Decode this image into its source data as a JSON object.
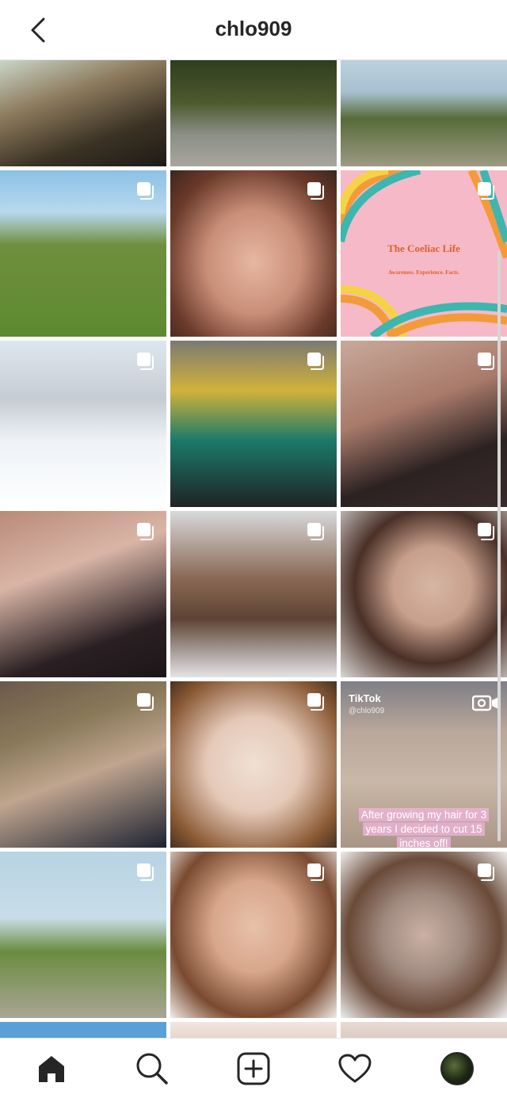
{
  "header": {
    "username": "chlo909"
  },
  "grid": {
    "tiles": [
      {
        "name": "post-selfie-sunset",
        "icon": "none",
        "bg": "linear-gradient(160deg,#c9d6c8 0%,#8c7a5c 35%,#3b3224 70%,#1d1b16 100%)"
      },
      {
        "name": "post-couple-legs-garden",
        "icon": "none",
        "bg": "linear-gradient(180deg,#2e3e1e 0%,#4d5a2e 40%,#8b8f86 70%,#a8a69c 100%)"
      },
      {
        "name": "post-countryside-path",
        "icon": "none",
        "bg": "linear-gradient(180deg,#bcd1de 0%,#a7c0cf 30%,#576b3a 55%,#9d9a83 100%)"
      },
      {
        "name": "post-field-dog",
        "icon": "multi",
        "bg": "linear-gradient(180deg,#8cc1e5 0%,#b7d9ef 25%,#6f8f3e 45%,#5d8a31 100%)"
      },
      {
        "name": "post-rainbow-makeup",
        "icon": "multi",
        "bg": "radial-gradient(ellipse at 50% 55%,#e7b7a2 0%,#c98f78 40%,#6b3a2a 75%,#3d261e 100%)"
      },
      {
        "name": "post-coeliac-graphic",
        "icon": "multi",
        "bg": "#f6b9c8",
        "graphic": true
      },
      {
        "name": "post-snow-walk",
        "icon": "multi",
        "bg": "linear-gradient(180deg,#dfe7ee 0%,#c6ccd3 35%,#eef2f6 60%,#ffffff 100%)"
      },
      {
        "name": "post-snow-couple",
        "icon": "multi",
        "bg": "linear-gradient(180deg,#7b7a72 0%,#d1b23a 30%,#1a7a6a 60%,#1f2324 100%)"
      },
      {
        "name": "post-glasses-dog",
        "icon": "multi",
        "bg": "linear-gradient(160deg,#c9a99a 0%,#a87a6a 40%,#2c2222 70%,#3a2b2b 100%)"
      },
      {
        "name": "post-glasses-selfie",
        "icon": "multi",
        "bg": "linear-gradient(160deg,#b98a7a 0%,#d9b5a6 35%,#2a1f22 75%,#1c1618 100%)"
      },
      {
        "name": "post-snowy-forest-path",
        "icon": "multi",
        "bg": "linear-gradient(180deg,#d8d9db 0%,#8a6a55 40%,#5e4334 65%,#e4e4e6 100%)"
      },
      {
        "name": "post-bob-makeup",
        "icon": "multi",
        "bg": "radial-gradient(ellipse at 55% 45%,#d7b6a4 0%,#c79f8c 30%,#4a3027 60%,#d9d6d2 100%)"
      },
      {
        "name": "post-christmas-tree-couple",
        "icon": "multi",
        "bg": "linear-gradient(160deg,#6b5a4a 0%,#8a7a5a 30%,#c0a58f 55%,#1d2331 100%)"
      },
      {
        "name": "post-flower-makeup",
        "icon": "multi",
        "bg": "radial-gradient(ellipse at 50% 50%,#f0e0d4 0%,#e5c9b8 40%,#8a5a35 80%,#4a3020 100%)"
      },
      {
        "name": "post-tiktok-pavement",
        "icon": "video",
        "bg": "linear-gradient(180deg,#7f7f86 0%,#b9a79b 30%,#c9b7a8 60%,#a89585 100%)",
        "tiktok": true
      },
      {
        "name": "post-lane-walk",
        "icon": "multi",
        "bg": "linear-gradient(180deg,#b8d3e3 0%,#c8dde8 40%,#6a8c3e 60%,#a9a595 100%)"
      },
      {
        "name": "post-curly-makeup",
        "icon": "multi",
        "bg": "radial-gradient(ellipse at 50% 45%,#e7c1aa 0%,#d8a78c 35%,#7a4a30 70%,#f1ece7 100%)"
      },
      {
        "name": "post-curly-tanktop",
        "icon": "multi",
        "bg": "radial-gradient(ellipse at 50% 50%,#cbb1a4 0%,#a08a80 35%,#6a4a38 65%,#eeeeee 100%)"
      },
      {
        "name": "post-partial-1",
        "icon": "none",
        "bg": "linear-gradient(180deg,#5aa0d8 0%,#5aa0d8 100%)"
      },
      {
        "name": "post-partial-2",
        "icon": "none",
        "bg": "linear-gradient(180deg,#f1e6e2 0%,#e8d6ce 100%)"
      },
      {
        "name": "post-partial-3",
        "icon": "none",
        "bg": "linear-gradient(180deg,#e7dad4 0%,#ddccc4 100%)"
      }
    ],
    "coeliac_title": "The Coeliac Life",
    "coeliac_subtitle": "Awareness. Experience. Facts.",
    "tiktok_label": "TikTok",
    "tiktok_handle": "@chlo909",
    "tiktok_caption": "After growing my hair for 3 years I decided to cut 15 inches off!"
  },
  "tabbar": {
    "items": [
      "home-icon",
      "search-icon",
      "new-post-icon",
      "activity-heart-icon",
      "profile-avatar"
    ]
  }
}
